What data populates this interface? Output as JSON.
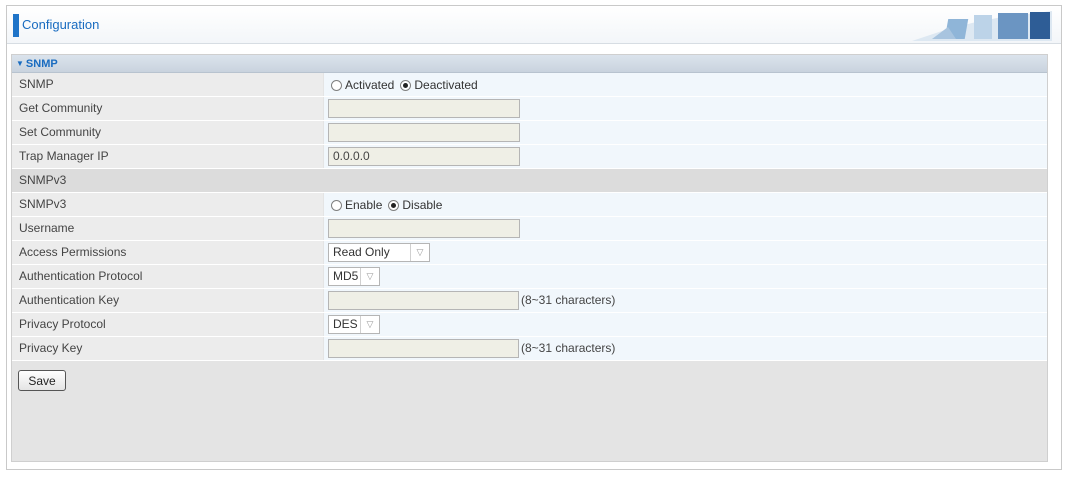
{
  "header": {
    "title": "Configuration"
  },
  "panel": {
    "title": "SNMP"
  },
  "snmp": {
    "snmp_label": "SNMP",
    "activated_label": "Activated",
    "deactivated_label": "Deactivated",
    "selected": "Deactivated",
    "get_community_label": "Get Community",
    "get_community_value": "",
    "set_community_label": "Set Community",
    "set_community_value": "",
    "trap_manager_label": "Trap Manager IP",
    "trap_manager_value": "0.0.0.0"
  },
  "snmpv3": {
    "section_label": "SNMPv3",
    "snmpv3_label": "SNMPv3",
    "enable_label": "Enable",
    "disable_label": "Disable",
    "selected": "Disable",
    "username_label": "Username",
    "username_value": "",
    "access_label": "Access Permissions",
    "access_value": "Read Only",
    "auth_protocol_label": "Authentication Protocol",
    "auth_protocol_value": "MD5",
    "auth_key_label": "Authentication Key",
    "auth_key_value": "",
    "auth_key_hint": "(8~31 characters)",
    "privacy_protocol_label": "Privacy Protocol",
    "privacy_protocol_value": "DES",
    "privacy_key_label": "Privacy Key",
    "privacy_key_value": "",
    "privacy_key_hint": "(8~31 characters)"
  },
  "actions": {
    "save_label": "Save"
  },
  "colors": {
    "accent": "#1f74c8",
    "title_text": "#1a6cc0",
    "label_bg": "#ececec",
    "value_bg": "#f1f7fc"
  }
}
